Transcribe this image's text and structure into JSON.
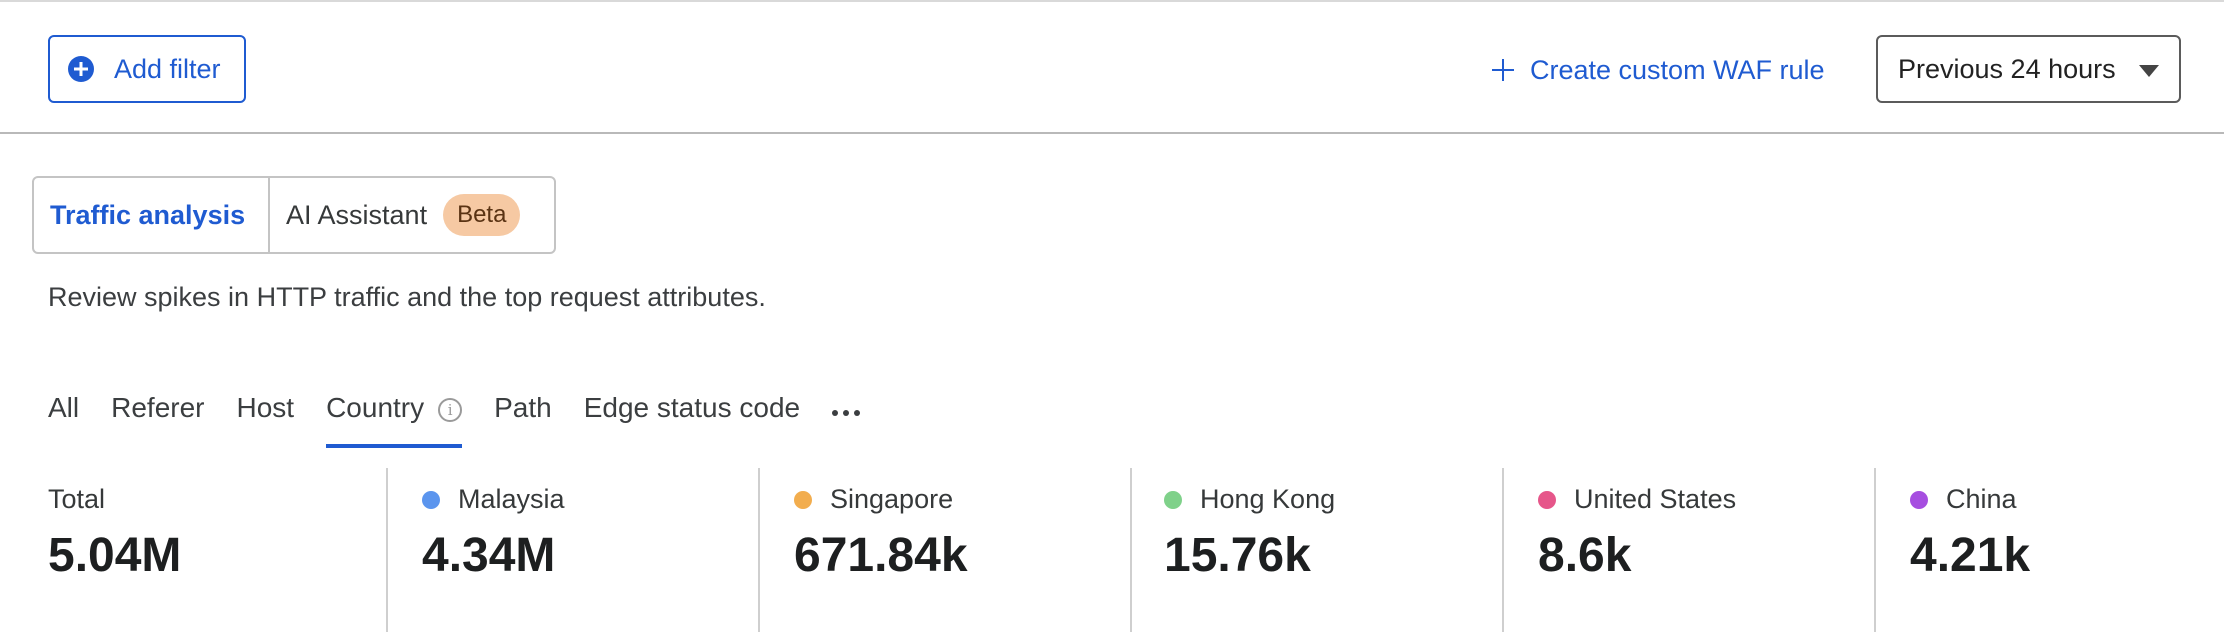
{
  "toolbar": {
    "add_filter_label": "Add filter",
    "create_rule_label": "Create custom WAF rule",
    "time_range_value": "Previous 24 hours"
  },
  "mode_tabs": {
    "traffic_analysis": "Traffic analysis",
    "ai_assistant": "AI Assistant",
    "beta_badge": "Beta"
  },
  "description": "Review spikes in HTTP traffic and the top request attributes.",
  "dimension_tabs": [
    {
      "label": "All",
      "active": false
    },
    {
      "label": "Referer",
      "active": false
    },
    {
      "label": "Host",
      "active": false
    },
    {
      "label": "Country",
      "active": true
    },
    {
      "label": "Path",
      "active": false
    },
    {
      "label": "Edge status code",
      "active": false
    }
  ],
  "stats": [
    {
      "label": "Total",
      "value": "5.04M",
      "color": null
    },
    {
      "label": "Malaysia",
      "value": "4.34M",
      "color": "#5b95ee"
    },
    {
      "label": "Singapore",
      "value": "671.84k",
      "color": "#f2ad4e"
    },
    {
      "label": "Hong Kong",
      "value": "15.76k",
      "color": "#7fd18a"
    },
    {
      "label": "United States",
      "value": "8.6k",
      "color": "#e6568a"
    },
    {
      "label": "China",
      "value": "4.21k",
      "color": "#a64ee0"
    }
  ],
  "colors": {
    "accent": "#1f5bd1",
    "beta_badge_bg": "#f6c9a3"
  }
}
